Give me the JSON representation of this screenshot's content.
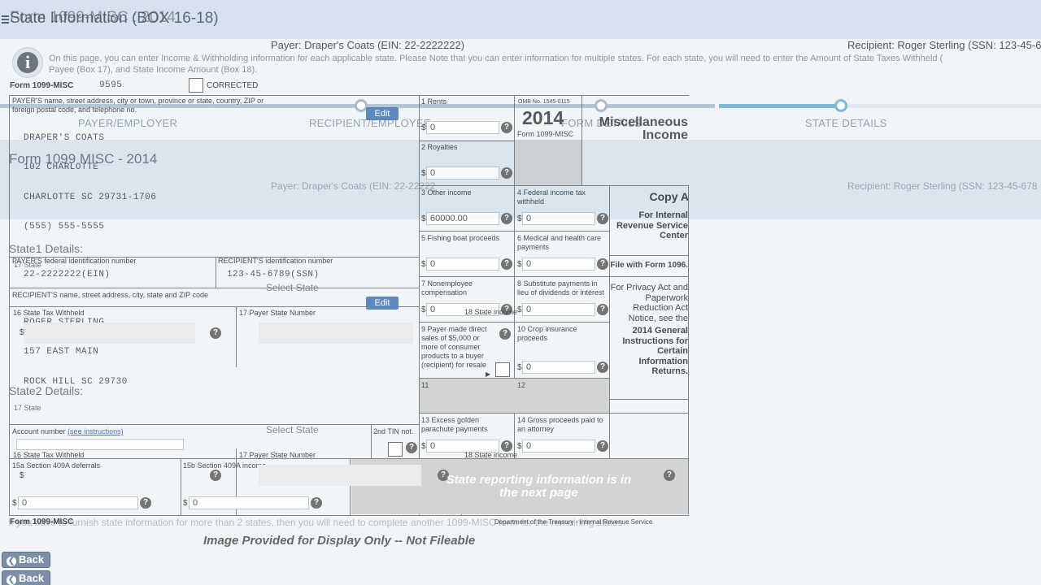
{
  "page": {
    "title": "State Information (BOX 16-18)",
    "payer": "Payer:  Draper's Coats (EIN: 22-2222222)",
    "recipient": "Recipient:  Roger Sterling (SSN: 123-45-678",
    "info_line1": "On this page, you can enter Income & Withholding information for each applicable state. Please Note that you can enter information for multiple states. For each state, you will need to enter the Amount of State Taxes Withheld (",
    "info_line2": "Payee (Box 17), and State Income Amount (Box 18).",
    "steps": [
      "PAYER/EMPLOYER",
      "RECIPIENT/EMPLOYEE",
      "FORM DETAILS",
      "STATE DETAILS"
    ],
    "form_heading": "Form 1099 MISC - 2014",
    "payer_faded": "Payer:  Draper's Coats (EIN: 22-22222",
    "recipient_faded": "Recipient:  Roger Sterling (SSN: 123-45-678",
    "state1": "State1 Details:",
    "state2": "State2 Details:",
    "select_state": "Select State",
    "bottom_note": "If you have to furnish state information for more than 2 states, then you will need to complete another 1099-MISC form for the remaining states.",
    "back": "Back"
  },
  "form": {
    "top_title": "Form 1099-MISC : 2014",
    "form_label": "Form 1099-MISC",
    "form_number": "9595",
    "corrected": "CORRECTED",
    "payer_box_label": "PAYER'S name, street address, city or town, province or state, country, ZIP or foreign postal code, and telephone no.",
    "payer_name": "DRAPER'S COATS",
    "payer_street": "102 CHARLOTTE",
    "payer_city": "CHARLOTTE SC 29731-1706",
    "payer_phone": "(555) 555-5555",
    "payer_fed_label": "PAYER'S federal identification number",
    "payer_fed_value": "22-2222222(EIN)",
    "recipient_id_label": "RECIPIENT'S identification number",
    "recipient_id_value": "123-45-6789(SSN)",
    "recipient_name_label": "RECIPIENT'S name, street address, city, state and ZIP code",
    "recipient_name": "ROGER STERLING",
    "recipient_street": "157 EAST MAIN",
    "recipient_city": "ROCK HILL SC 29730",
    "account_label": "Account number",
    "account_link": "(see instructions)",
    "tin_label": "2nd TIN not.",
    "box15a": "15a Section 409A deferrals",
    "box15b": "15b Section 409A income",
    "box16": "16  State Tax Withheld",
    "box17": "17  State",
    "box17b": "17  Payer State Number",
    "box18": "18  State income",
    "edit": "Edit",
    "omb": "OMB No. 1545-0115",
    "year": "2014",
    "form_small": "Form 1099-MISC",
    "title_line1": "Miscellaneous",
    "title_line2": "Income",
    "box1": "1  Rents",
    "box2": "2  Royalties",
    "box3": "3  Other income",
    "box3_value": "60000.00",
    "box4": "4  Federal income tax withheld",
    "box5": "5  Fishing boat proceeds",
    "box6": "6  Medical and health care payments",
    "box7": "7  Nonemployee compensation",
    "box8": "8  Substitute payments in lieu of dividends or interest",
    "box9": "9  Payer made direct sales of $5,000 or more of consumer products to a buyer (recipient) for resale",
    "box10": "10  Crop insurance proceeds",
    "box11": "11",
    "box12": "12",
    "box13": "13  Excess golden parachute payments",
    "box14": "14  Gross proceeds paid to an attorney",
    "zero": "0",
    "dollar": "$",
    "copy_a": "Copy A",
    "for_irs": "For Internal Revenue Service Center",
    "file_with": "File with Form 1096.",
    "privacy": "For Privacy Act and Paperwork Reduction Act Notice, see the",
    "general": "2014 General Instructions for Certain Information Returns.",
    "state_next": "State reporting information is in the next page",
    "footer_form": "Form 1099-MISC",
    "footer_dept": "Department of the Treasury - Internal Revenue Service",
    "disclaimer": "Image Provided for Display Only -- Not Fileable"
  }
}
